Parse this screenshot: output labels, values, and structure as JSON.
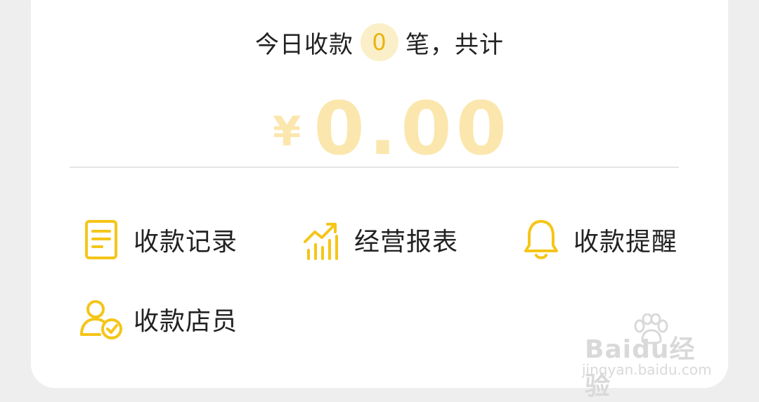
{
  "summary": {
    "prefix": "今日收款",
    "count": "0",
    "suffix": "笔，共计"
  },
  "amount": {
    "currency": "¥",
    "value": "0.00"
  },
  "menu": [
    {
      "label": "收款记录",
      "icon": "document-icon"
    },
    {
      "label": "经营报表",
      "icon": "chart-growth-icon"
    },
    {
      "label": "收款提醒",
      "icon": "bell-icon"
    },
    {
      "label": "收款店员",
      "icon": "staff-check-icon"
    }
  ],
  "watermark": {
    "brand": "Baidu经验",
    "site": "jingyan.baidu.com"
  },
  "colors": {
    "accent": "#f5c518",
    "accent_light": "#fbe7ad",
    "badge_bg": "#fbefc9",
    "text": "#222222",
    "background": "#eeeeee",
    "card": "#ffffff"
  }
}
